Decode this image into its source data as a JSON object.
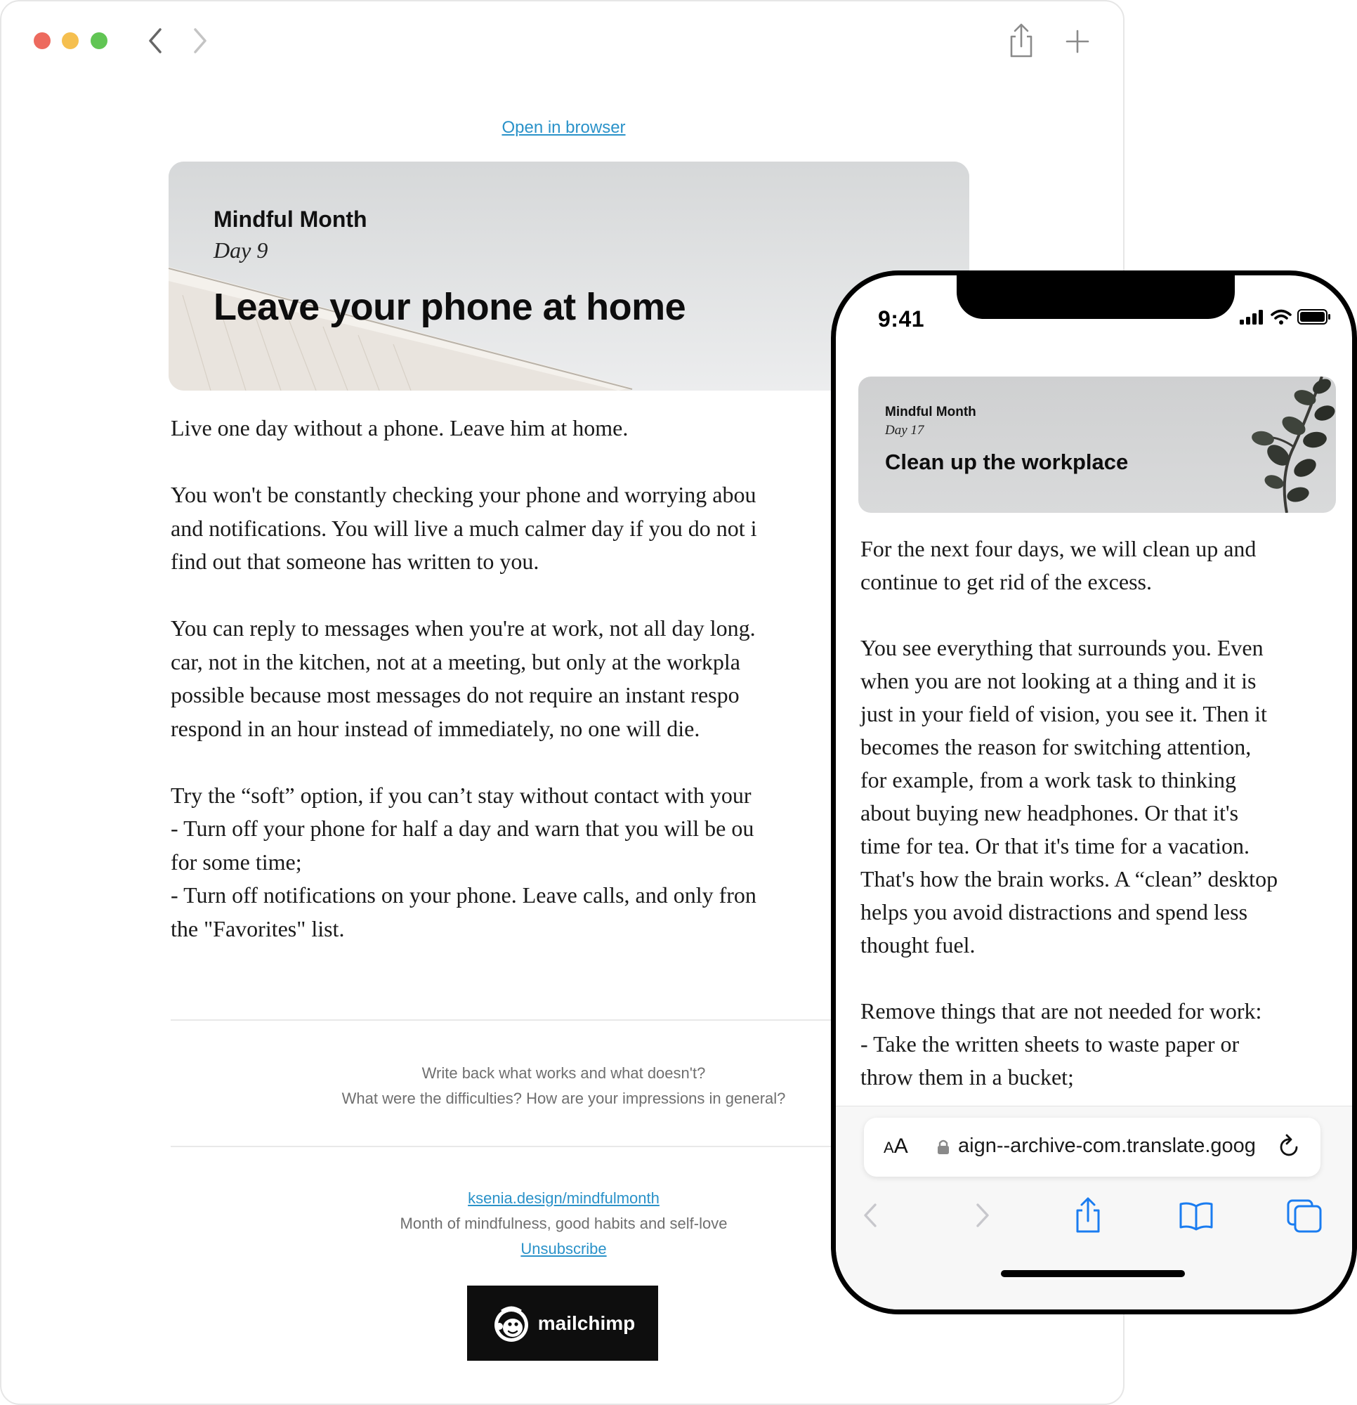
{
  "desktop": {
    "open_in_browser": "Open in browser",
    "hero": {
      "brand": "Mindful Month",
      "day": "Day 9",
      "title": "Leave your phone at home"
    },
    "body": {
      "p1": "Live one day without a phone. Leave him at home.",
      "p2": [
        "You won't be constantly checking your phone and worrying abou",
        "and notifications. You will live a much calmer day if you do not i",
        "find out that someone has written to you."
      ],
      "p3": [
        "You can reply to messages when you're at work, not all day long.",
        "car, not in the kitchen, not at a meeting, but only at the workpla",
        "possible because most messages do not require an instant respo",
        "respond in an hour instead of immediately, no one will die."
      ],
      "p4": [
        "Try the “soft” option, if you can’t stay without contact with your",
        "- Turn off your phone for half a day and warn that you will be ou",
        "for some time;",
        "- Turn off notifications on your phone. Leave calls, and only fron",
        "the \"Favorites\" list."
      ]
    },
    "feedback": {
      "line1": "Write back what works and what doesn't?",
      "line2": "What were the difficulties? How are your impressions in general?"
    },
    "footer": {
      "link": "ksenia.design/mindfulmonth",
      "tagline": "Month of mindfulness, good habits and self-love",
      "unsubscribe": "Unsubscribe"
    },
    "badge": "mailchimp"
  },
  "phone": {
    "time": "9:41",
    "hero": {
      "brand": "Mindful Month",
      "day": "Day 17",
      "title": "Clean up the workplace"
    },
    "body": {
      "p1": [
        "For the next four days, we will clean up and",
        "continue to get rid of the excess."
      ],
      "p2": [
        "You see everything that surrounds you. Even",
        "when you are not looking at a thing and it is",
        "just in your field of vision, you see it. Then it",
        "becomes the reason for switching attention,",
        "for example, from a work task to thinking",
        "about buying new headphones. Or that it's",
        "time for tea. Or that it's time for a vacation.",
        "That's how the brain works. A “clean” desktop",
        "helps you avoid distractions and spend less",
        "thought fuel."
      ],
      "p3": [
        "Remove things that are not needed for work:",
        "- Take the written sheets to waste paper or",
        "throw them in a bucket;"
      ]
    },
    "address_bar": {
      "aa_big": "A",
      "aa_small": "A",
      "url": "aign--archive-com.translate.goog"
    }
  },
  "colors": {
    "link": "#2a92c9",
    "traffic_red": "#ed6a5e",
    "traffic_yellow": "#f5bf4f",
    "traffic_green": "#61c554",
    "ios_blue": "#1a7cf0"
  }
}
